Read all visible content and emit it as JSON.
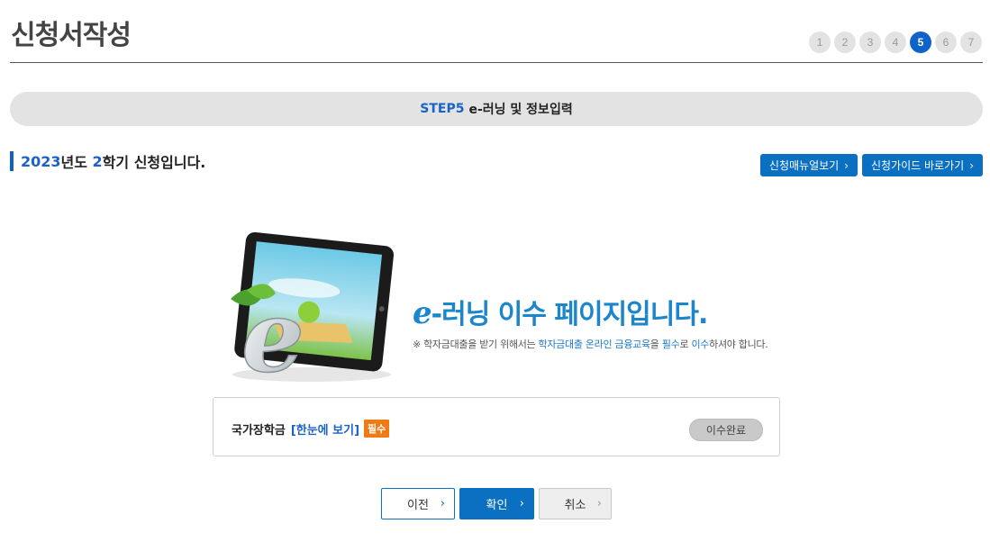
{
  "header": {
    "title": "신청서작성",
    "steps": [
      "1",
      "2",
      "3",
      "4",
      "5",
      "6",
      "7"
    ],
    "active_step": "5"
  },
  "step_bar": {
    "code": "STEP5",
    "label": "e-러닝 및 정보입력"
  },
  "semester": {
    "year": "2023",
    "year_suffix": "년도 ",
    "term": "2",
    "term_suffix": "학기 신청입니다."
  },
  "top_buttons": {
    "manual": "신청매뉴얼보기",
    "guide": "신청가이드 바로가기"
  },
  "hero": {
    "e_letter": "e",
    "heading_rest": "-러닝 이수 페이지입니다.",
    "note_parts": [
      "※ 학자금대출을 받기 위해서는 ",
      "학자금대출 온라인 금융교육",
      "을 ",
      "필수",
      "로 ",
      "이수",
      "하셔야 합니다."
    ]
  },
  "course": {
    "name": "국가장학금",
    "link": "[한눈에 보기]",
    "badge": "필수",
    "status": "이수완료"
  },
  "nav": {
    "prev": "이전",
    "ok": "확인",
    "cancel": "취소"
  },
  "colors": {
    "accent": "#0e62c9",
    "button_blue": "#0b6fc2",
    "badge_orange": "#f07a14"
  }
}
